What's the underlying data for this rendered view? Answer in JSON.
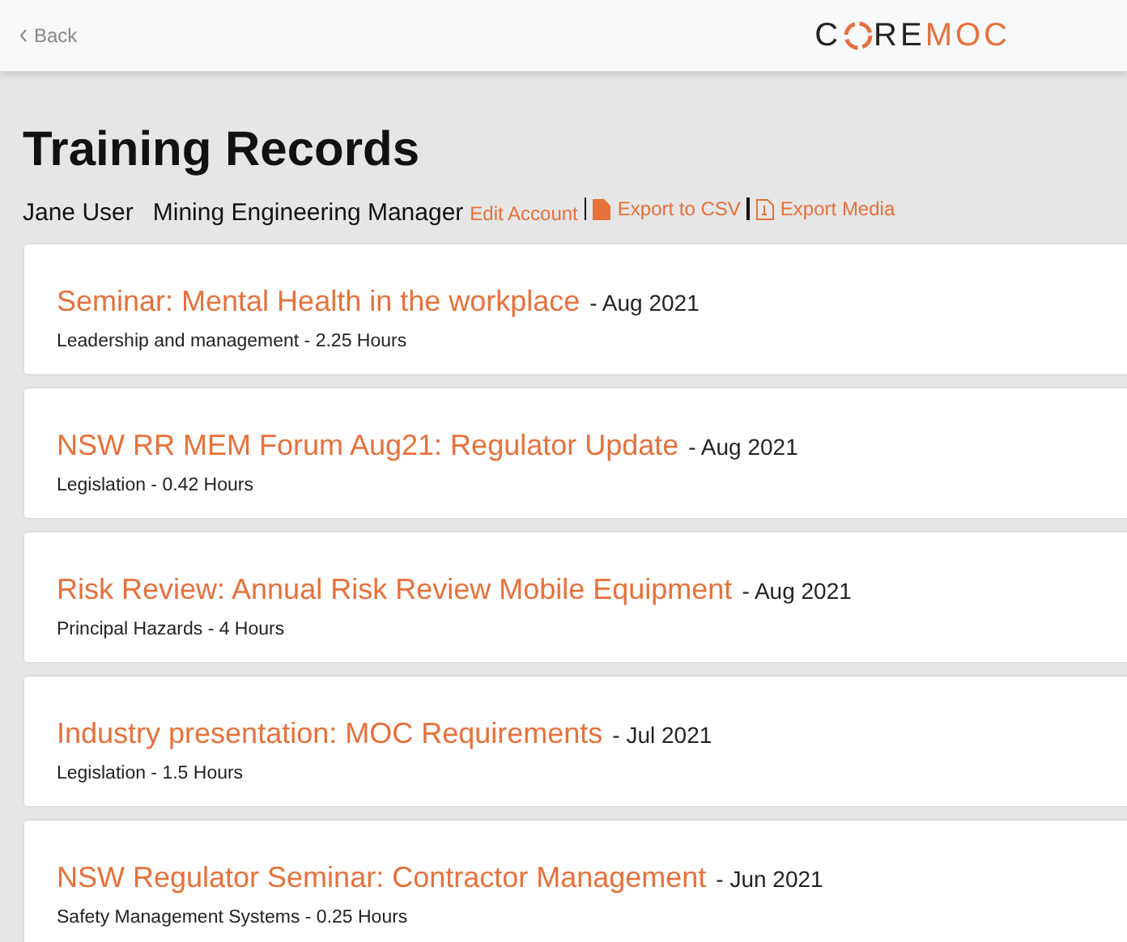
{
  "header": {
    "back": "Back",
    "logo": {
      "first": "C",
      "middle": "RE",
      "last": "MOC"
    }
  },
  "title": "Training Records",
  "user": {
    "name": "Jane User",
    "role": "Mining Engineering Manager"
  },
  "actions": [
    {
      "kind": "plain",
      "label": "Edit Account"
    },
    {
      "kind": "file",
      "label": "Export to CSV"
    },
    {
      "kind": "media",
      "label": "Export Media"
    }
  ],
  "records": [
    {
      "title": "Seminar: Mental Health in the workplace",
      "date": "- Aug 2021",
      "detail": "Leadership and management - 2.25 Hours"
    },
    {
      "title": "NSW RR MEM Forum Aug21: Regulator Update",
      "date": "- Aug 2021",
      "detail": "Legislation - 0.42 Hours"
    },
    {
      "title": "Risk Review: Annual Risk Review Mobile Equipment",
      "date": "- Aug 2021",
      "detail": "Principal Hazards - 4 Hours"
    },
    {
      "title": "Industry presentation: MOC Requirements",
      "date": "- Jul 2021",
      "detail": "Legislation - 1.5 Hours"
    },
    {
      "title": "NSW Regulator Seminar: Contractor Management",
      "date": "- Jun 2021",
      "detail": "Safety Management Systems - 0.25 Hours"
    }
  ]
}
